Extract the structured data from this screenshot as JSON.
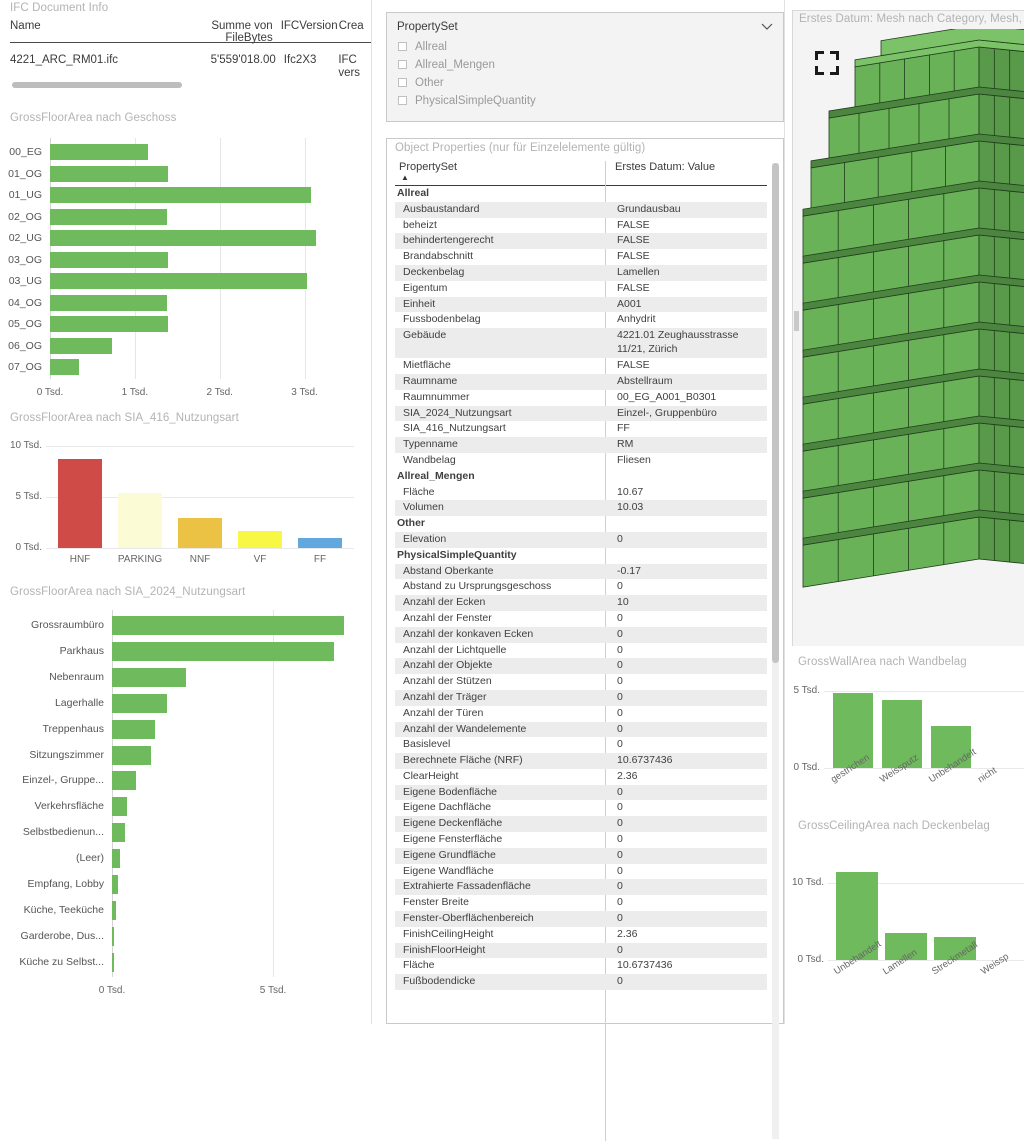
{
  "doc_info": {
    "title": "IFC Document Info",
    "columns": [
      "Name",
      "Summe von FileBytes",
      "IFCVersion",
      "Crea"
    ],
    "rows": [
      {
        "name": "4221_ARC_RM01.ifc",
        "filebytes": "5'559'018.00",
        "ifcversion": "Ifc2X3",
        "created": "IFC",
        "created2": "vers"
      }
    ]
  },
  "propertyset_filter": {
    "title": "PropertySet",
    "chevron": "chevron-down-icon",
    "items": [
      "Allreal",
      "Allreal_Mengen",
      "Other",
      "PhysicalSimpleQuantity"
    ]
  },
  "object_properties": {
    "title": "Object Properties (nur für Einzelelemente gültig)",
    "columns": [
      "PropertySet",
      "Erstes Datum: Value"
    ],
    "rows": [
      {
        "group": true,
        "name": "Allreal",
        "value": ""
      },
      {
        "group": false,
        "name": "Ausbaustandard",
        "value": "Grundausbau"
      },
      {
        "group": false,
        "name": "beheizt",
        "value": "FALSE"
      },
      {
        "group": false,
        "name": "behindertengerecht",
        "value": "FALSE"
      },
      {
        "group": false,
        "name": "Brandabschnitt",
        "value": "FALSE"
      },
      {
        "group": false,
        "name": "Deckenbelag",
        "value": "Lamellen"
      },
      {
        "group": false,
        "name": "Eigentum",
        "value": "FALSE"
      },
      {
        "group": false,
        "name": "Einheit",
        "value": "A001"
      },
      {
        "group": false,
        "name": "Fussbodenbelag",
        "value": "Anhydrit"
      },
      {
        "group": false,
        "name": "Gebäude",
        "value": "4221.01 Zeughausstrasse",
        "value2": "11/21, Zürich",
        "tall": true
      },
      {
        "group": false,
        "name": "Mietfläche",
        "value": "FALSE"
      },
      {
        "group": false,
        "name": "Raumname",
        "value": "Abstellraum"
      },
      {
        "group": false,
        "name": "Raumnummer",
        "value": "00_EG_A001_B0301"
      },
      {
        "group": false,
        "name": "SIA_2024_Nutzungsart",
        "value": "Einzel-, Gruppenbüro"
      },
      {
        "group": false,
        "name": "SIA_416_Nutzungsart",
        "value": "FF"
      },
      {
        "group": false,
        "name": "Typenname",
        "value": "RM"
      },
      {
        "group": false,
        "name": "Wandbelag",
        "value": "Fliesen"
      },
      {
        "group": true,
        "name": "Allreal_Mengen",
        "value": ""
      },
      {
        "group": false,
        "name": "Fläche",
        "value": "10.67"
      },
      {
        "group": false,
        "name": "Volumen",
        "value": "10.03"
      },
      {
        "group": true,
        "name": "Other",
        "value": ""
      },
      {
        "group": false,
        "name": "Elevation",
        "value": "0"
      },
      {
        "group": true,
        "name": "PhysicalSimpleQuantity",
        "value": ""
      },
      {
        "group": false,
        "name": "Abstand Oberkante",
        "value": "-0.17"
      },
      {
        "group": false,
        "name": "Abstand zu Ursprungsgeschoss",
        "value": "0"
      },
      {
        "group": false,
        "name": "Anzahl der Ecken",
        "value": "10"
      },
      {
        "group": false,
        "name": "Anzahl der Fenster",
        "value": "0"
      },
      {
        "group": false,
        "name": "Anzahl der konkaven Ecken",
        "value": "0"
      },
      {
        "group": false,
        "name": "Anzahl der Lichtquelle",
        "value": "0"
      },
      {
        "group": false,
        "name": "Anzahl der Objekte",
        "value": "0"
      },
      {
        "group": false,
        "name": "Anzahl der Stützen",
        "value": "0"
      },
      {
        "group": false,
        "name": "Anzahl der Träger",
        "value": "0"
      },
      {
        "group": false,
        "name": "Anzahl der Türen",
        "value": "0"
      },
      {
        "group": false,
        "name": "Anzahl der Wandelemente",
        "value": "0"
      },
      {
        "group": false,
        "name": "Basislevel",
        "value": "0"
      },
      {
        "group": false,
        "name": "Berechnete Fläche (NRF)",
        "value": "10.6737436"
      },
      {
        "group": false,
        "name": "ClearHeight",
        "value": "2.36"
      },
      {
        "group": false,
        "name": "Eigene Bodenfläche",
        "value": "0"
      },
      {
        "group": false,
        "name": "Eigene Dachfläche",
        "value": "0"
      },
      {
        "group": false,
        "name": "Eigene Deckenfläche",
        "value": "0"
      },
      {
        "group": false,
        "name": "Eigene Fensterfläche",
        "value": "0"
      },
      {
        "group": false,
        "name": "Eigene Grundfläche",
        "value": "0"
      },
      {
        "group": false,
        "name": "Eigene Wandfläche",
        "value": "0"
      },
      {
        "group": false,
        "name": "Extrahierte Fassadenfläche",
        "value": "0"
      },
      {
        "group": false,
        "name": "Fenster Breite",
        "value": "0"
      },
      {
        "group": false,
        "name": "Fenster-Oberflächenbereich",
        "value": "0"
      },
      {
        "group": false,
        "name": "FinishCeilingHeight",
        "value": "2.36"
      },
      {
        "group": false,
        "name": "FinishFloorHeight",
        "value": "0"
      },
      {
        "group": false,
        "name": "Fläche",
        "value": "10.6737436"
      },
      {
        "group": false,
        "name": "Fußbodendicke",
        "value": "0"
      }
    ]
  },
  "mesh_view": {
    "title": "Erstes Datum: Mesh nach Category, Mesh, Ty",
    "focus_icon": "focus-frame-icon",
    "model_color": "#6FB55A"
  },
  "chart_data": [
    {
      "type": "bar",
      "orientation": "horizontal",
      "title": "GrossFloorArea nach Geschoss",
      "categories": [
        "00_EG",
        "01_OG",
        "01_UG",
        "02_OG",
        "02_UG",
        "03_OG",
        "03_UG",
        "04_OG",
        "05_OG",
        "06_OG",
        "07_OG"
      ],
      "values": [
        1160,
        1390,
        3080,
        1375,
        3130,
        1390,
        3030,
        1380,
        1390,
        730,
        340
      ],
      "xlabel": "",
      "ylabel": "",
      "xticks": [
        "0 Tsd.",
        "1 Tsd.",
        "2 Tsd.",
        "3 Tsd."
      ],
      "xtickvals": [
        0,
        1000,
        2000,
        3000
      ],
      "xlim": [
        0,
        3300
      ],
      "color": "#6FBA5C",
      "grid": true
    },
    {
      "type": "bar",
      "orientation": "vertical",
      "title": "GrossFloorArea nach SIA_416_Nutzungsart",
      "categories": [
        "HNF",
        "PARKING",
        "NNF",
        "VF",
        "FF"
      ],
      "values": [
        8700,
        5400,
        2900,
        1700,
        1000
      ],
      "colors": [
        "#CE4B47",
        "#FBFBD5",
        "#EBC243",
        "#F7F744",
        "#60A8DE"
      ],
      "yticks": [
        "0 Tsd.",
        "5 Tsd.",
        "10 Tsd."
      ],
      "ytickvals": [
        0,
        5000,
        10000
      ],
      "ylim": [
        0,
        10000
      ],
      "grid": true
    },
    {
      "type": "bar",
      "orientation": "horizontal",
      "title": "GrossFloorArea nach SIA_2024_Nutzungsart",
      "categories": [
        "Grossraumbüro",
        "Parkhaus",
        "Nebenraum",
        "Lagerhalle",
        "Treppenhaus",
        "Sitzungszimmer",
        "Einzel-, Gruppe...",
        "Verkehrsfläche",
        "Selbstbedienun...",
        "(Leer)",
        "Empfang, Lobby",
        "Küche, Teeküche",
        "Garderobe, Dus...",
        "Küche zu Selbst..."
      ],
      "values": [
        7200,
        6900,
        2300,
        1700,
        1350,
        1200,
        740,
        460,
        400,
        260,
        200,
        130,
        60,
        40
      ],
      "xticks": [
        "0 Tsd.",
        "5 Tsd."
      ],
      "xtickvals": [
        0,
        5000
      ],
      "xlim": [
        0,
        7700
      ],
      "color": "#6FBA5C",
      "grid": true
    },
    {
      "type": "bar",
      "orientation": "vertical",
      "title": "GrossWallArea nach Wandbelag",
      "categories": [
        "gestrichen",
        "Weissputz",
        "Unbehandelt",
        "nicht"
      ],
      "values": [
        4900,
        4450,
        2700,
        0
      ],
      "yticks": [
        "0 Tsd.",
        "5 Tsd."
      ],
      "ytickvals": [
        0,
        5000
      ],
      "ylim": [
        0,
        5200
      ],
      "color": "#6FBA5C",
      "grid": true
    },
    {
      "type": "bar",
      "orientation": "vertical",
      "title": "GrossCeilingArea nach Deckenbelag",
      "categories": [
        "Unbehandelt",
        "Lamellen",
        "Streckmetall",
        "Weissp"
      ],
      "values": [
        11500,
        3500,
        3000,
        0
      ],
      "yticks": [
        "0 Tsd.",
        "10 Tsd."
      ],
      "ytickvals": [
        0,
        10000
      ],
      "ylim": [
        0,
        12500
      ],
      "color": "#6FBA5C",
      "grid": true
    }
  ]
}
